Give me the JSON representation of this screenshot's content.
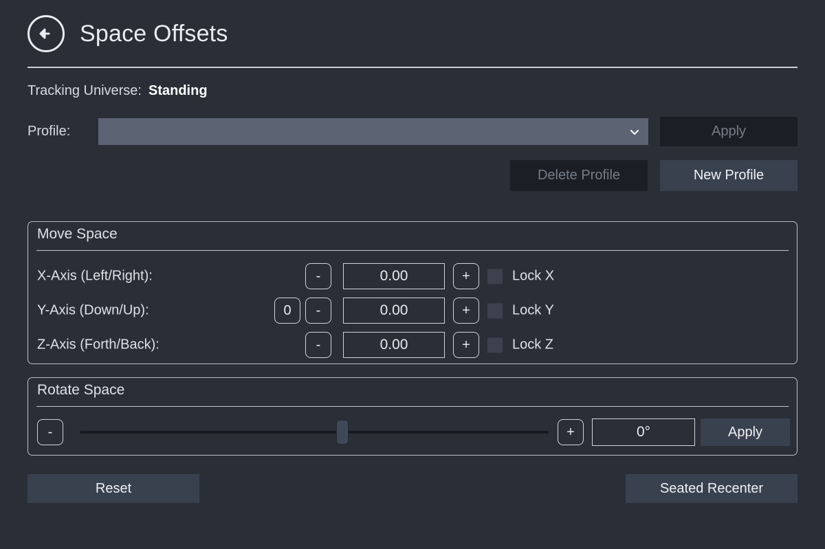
{
  "header": {
    "back_icon": "back-arrow-circle-icon",
    "title": "Space Offsets"
  },
  "tracking": {
    "label": "Tracking Universe:",
    "value": "Standing"
  },
  "profile": {
    "label": "Profile:",
    "selected": "",
    "placeholder": "",
    "chevron_icon": "chevron-down-icon",
    "apply_label": "Apply",
    "apply_enabled": false,
    "delete_label": "Delete Profile",
    "delete_enabled": false,
    "new_label": "New Profile",
    "new_enabled": true
  },
  "move_space": {
    "title": "Move Space",
    "rows": [
      {
        "label": "X-Axis (Left/Right):",
        "zero_label": "",
        "has_zero": false,
        "minus_label": "-",
        "value": "0.00",
        "plus_label": "+",
        "lock_label": "Lock X",
        "lock_checked": false
      },
      {
        "label": "Y-Axis (Down/Up):",
        "zero_label": "0",
        "has_zero": true,
        "minus_label": "-",
        "value": "0.00",
        "plus_label": "+",
        "lock_label": "Lock Y",
        "lock_checked": false
      },
      {
        "label": "Z-Axis (Forth/Back):",
        "zero_label": "",
        "has_zero": false,
        "minus_label": "-",
        "value": "0.00",
        "plus_label": "+",
        "lock_label": "Lock Z",
        "lock_checked": false
      }
    ]
  },
  "rotate_space": {
    "title": "Rotate Space",
    "minus_label": "-",
    "plus_label": "+",
    "slider_percent": 56,
    "degrees_value": "0°",
    "apply_label": "Apply"
  },
  "footer": {
    "reset_label": "Reset",
    "recenter_label": "Seated Recenter"
  },
  "colors": {
    "background": "#2a2e37",
    "panel_border": "#b9c0cb",
    "text_primary": "#dfe3ea",
    "text_bright": "#ffffff",
    "button_enabled_bg": "#3a414e",
    "button_disabled_bg": "#1b1e25",
    "button_disabled_text": "#767d88",
    "dropdown_bg": "#5c6473",
    "checkbox_bg": "#3b414d",
    "slider_track": "#171a20",
    "slider_handle": "#404756"
  }
}
